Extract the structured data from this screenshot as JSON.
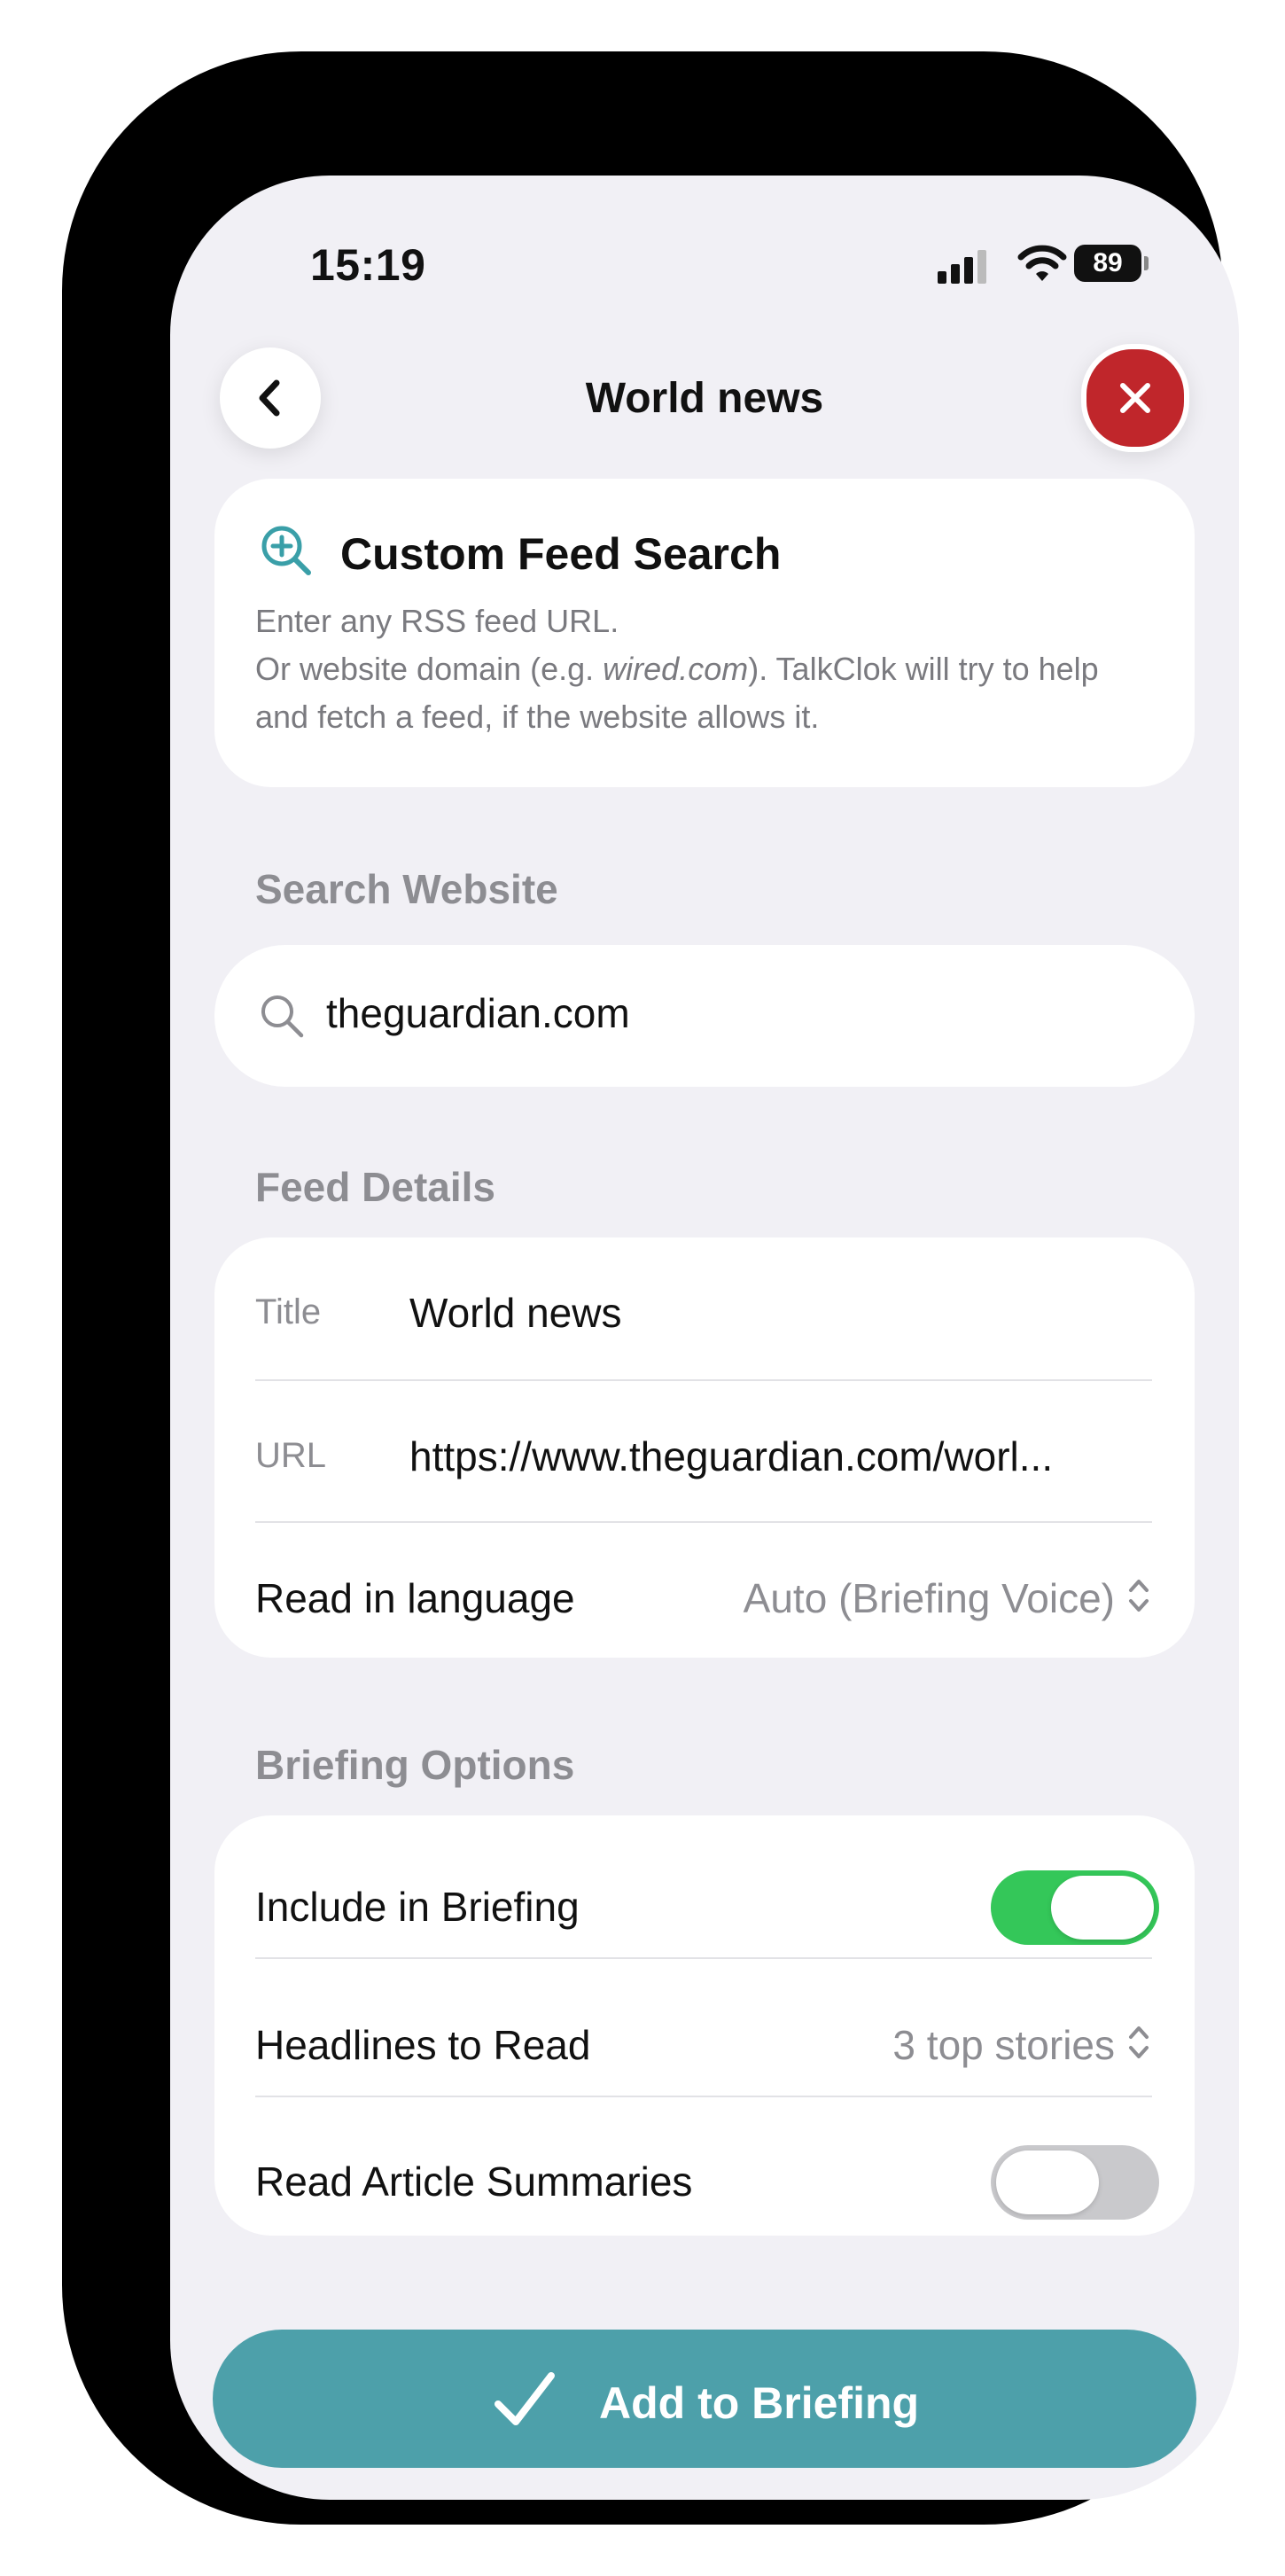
{
  "status_bar": {
    "time": "15:19",
    "battery": "89"
  },
  "nav": {
    "title": "World news"
  },
  "info": {
    "title": "Custom Feed Search",
    "line1": "Enter any RSS feed URL.",
    "line2_prefix": "Or website domain (e.g. ",
    "line2_example": "wired.com",
    "line2_suffix": "). TalkClok will try to help and fetch a feed, if the website allows it."
  },
  "search": {
    "section_label": "Search Website",
    "value": "theguardian.com"
  },
  "feed_details": {
    "section_label": "Feed Details",
    "title_label": "Title",
    "title_value": "World news",
    "url_label": "URL",
    "url_value": "https://www.theguardian.com/worl...",
    "language_label": "Read in language",
    "language_value": "Auto (Briefing Voice)"
  },
  "briefing_options": {
    "section_label": "Briefing Options",
    "include_label": "Include in Briefing",
    "include_on": true,
    "headlines_label": "Headlines to Read",
    "headlines_value": "3 top stories",
    "summaries_label": "Read Article Summaries",
    "summaries_on": false
  },
  "action": {
    "add_label": "Add to Briefing"
  },
  "colors": {
    "accent": "#4da0aa",
    "toggle_on": "#34c759",
    "close": "#c0262b",
    "search_icon": "#3a9fa8"
  }
}
